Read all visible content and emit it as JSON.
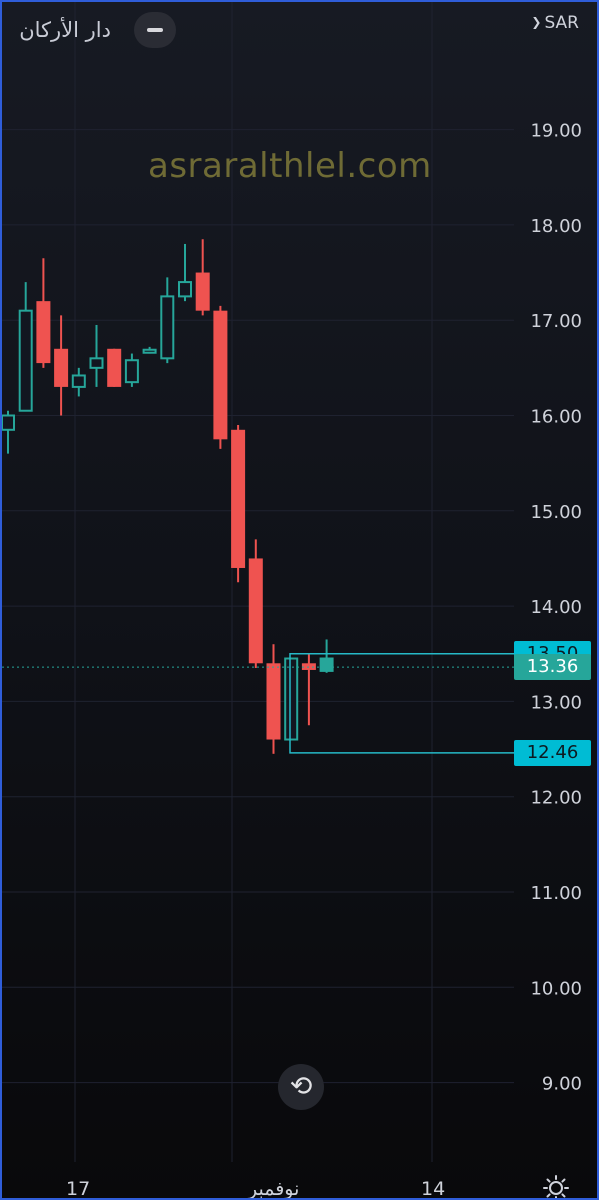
{
  "header": {
    "stock_name": "دار الأركان",
    "currency": "SAR",
    "collapse_icon": "minus-icon",
    "currency_icon": "chevron-down-icon"
  },
  "watermark": "asraralthlel.com",
  "colors": {
    "up": "#26a69a",
    "down": "#ef5350",
    "tag_cyan": "#00bcd4",
    "tag_current": "#26a69a",
    "grid": "#1f2230",
    "box": "#26b9c7"
  },
  "price_tags": {
    "high": "13.50",
    "current": "13.36",
    "low": "12.46"
  },
  "footer": {
    "reset_icon": "reset-icon",
    "settings_icon": "sun-icon"
  },
  "chart_data": {
    "type": "candlestick",
    "ylim": [
      8.5,
      19.6
    ],
    "y_ticks": [
      "19.00",
      "18.00",
      "17.00",
      "16.00",
      "15.00",
      "14.00",
      "13.00",
      "12.00",
      "11.00",
      "10.00",
      "9.00"
    ],
    "x_tick_labels": [
      "17",
      "نوفمبر",
      "14"
    ],
    "current_price": 13.36,
    "range_box": {
      "high": 13.5,
      "low": 12.46
    },
    "candles": [
      {
        "o": 15.85,
        "h": 16.05,
        "l": 15.6,
        "c": 16.0
      },
      {
        "o": 16.05,
        "h": 17.4,
        "l": 16.05,
        "c": 17.1
      },
      {
        "o": 17.2,
        "h": 17.65,
        "l": 16.5,
        "c": 16.55
      },
      {
        "o": 16.7,
        "h": 17.05,
        "l": 16.0,
        "c": 16.3
      },
      {
        "o": 16.3,
        "h": 16.5,
        "l": 16.2,
        "c": 16.42
      },
      {
        "o": 16.5,
        "h": 16.95,
        "l": 16.3,
        "c": 16.6
      },
      {
        "o": 16.7,
        "h": 16.7,
        "l": 16.3,
        "c": 16.3
      },
      {
        "o": 16.35,
        "h": 16.65,
        "l": 16.3,
        "c": 16.58
      },
      {
        "o": 16.67,
        "h": 16.72,
        "l": 16.65,
        "c": 16.69
      },
      {
        "o": 16.6,
        "h": 17.45,
        "l": 16.55,
        "c": 17.25
      },
      {
        "o": 17.25,
        "h": 17.8,
        "l": 17.2,
        "c": 17.4
      },
      {
        "o": 17.5,
        "h": 17.85,
        "l": 17.05,
        "c": 17.1
      },
      {
        "o": 17.1,
        "h": 17.15,
        "l": 15.65,
        "c": 15.75
      },
      {
        "o": 15.85,
        "h": 15.9,
        "l": 14.25,
        "c": 14.4
      },
      {
        "o": 14.5,
        "h": 14.7,
        "l": 13.35,
        "c": 13.4
      },
      {
        "o": 13.4,
        "h": 13.6,
        "l": 12.45,
        "c": 12.6
      },
      {
        "o": 12.6,
        "h": 13.45,
        "l": 12.6,
        "c": 13.45
      },
      {
        "o": 13.4,
        "h": 13.5,
        "l": 12.75,
        "c": 13.33
      },
      {
        "o": 13.32,
        "h": 13.65,
        "l": 13.3,
        "c": 13.45
      }
    ]
  }
}
